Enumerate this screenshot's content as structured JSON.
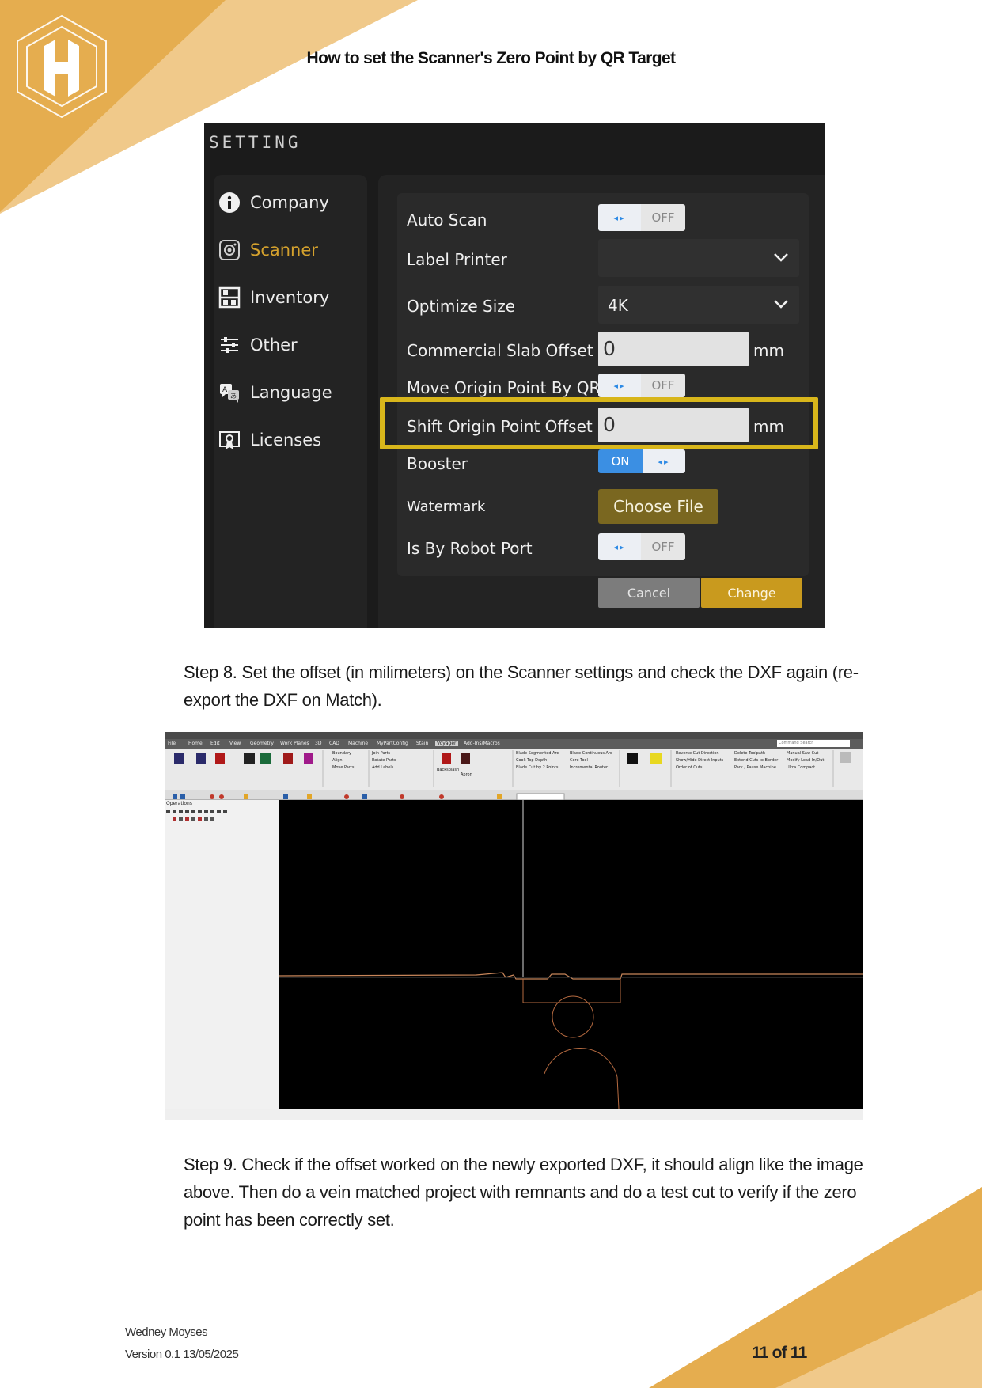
{
  "document": {
    "title": "How to set the Scanner's Zero Point by QR Target",
    "step8": "Step 8. Set the offset (in milimeters) on the Scanner settings and check the DXF again (re-export the DXF on Match).",
    "step9": "Step 9. Check if the offset worked on the newly exported DXF, it should align like the image above. Then do a vein matched project with remnants and do a test cut to verify if the zero point has been correctly set."
  },
  "settings_screenshot": {
    "title": "SETTING",
    "sidebar": [
      {
        "label": "Company",
        "icon": "info-icon"
      },
      {
        "label": "Scanner",
        "icon": "camera-icon",
        "active": true
      },
      {
        "label": "Inventory",
        "icon": "inventory-icon"
      },
      {
        "label": "Other",
        "icon": "sliders-icon"
      },
      {
        "label": "Language",
        "icon": "language-icon"
      },
      {
        "label": "Licenses",
        "icon": "license-icon"
      }
    ],
    "fields": {
      "auto_scan": {
        "label": "Auto Scan",
        "state": "OFF"
      },
      "label_printer": {
        "label": "Label Printer",
        "value": ""
      },
      "optimize_size": {
        "label": "Optimize Size",
        "value": "4K"
      },
      "commercial_slab_offset": {
        "label": "Commercial Slab Offset",
        "value": "0",
        "unit": "mm"
      },
      "move_origin": {
        "label": "Move Origin Point By QR",
        "state": "OFF"
      },
      "shift_origin": {
        "label": "Shift Origin Point Offset",
        "value": "0",
        "unit": "mm"
      },
      "booster": {
        "label": "Booster",
        "state": "ON"
      },
      "watermark": {
        "label": "Watermark",
        "button": "Choose File"
      },
      "robot_port": {
        "label": "Is By Robot Port",
        "state": "OFF"
      }
    },
    "buttons": {
      "cancel": "Cancel",
      "change": "Change"
    },
    "colors": {
      "accent": "#d4a12d",
      "highlight": "#d8b61b",
      "toggle_on": "#3b8fe3"
    }
  },
  "cad_screenshot": {
    "menu": [
      "File",
      "Home",
      "Edit",
      "View",
      "Geometry",
      "Work Planes",
      "3D",
      "CAD",
      "Machine",
      "MyPartConfig",
      "Stain",
      "Voyager",
      "Add-Ins/Macros"
    ],
    "search_placeholder": "Command Search",
    "operations_title": "Operations",
    "ribbon_labels": [
      "Boundary",
      "Align",
      "Move Parts",
      "Join Parts",
      "Rotate Parts",
      "Add Labels",
      "Blade Segmented Arc",
      "Cook Top Depth",
      "Blade Cut by 2 Points",
      "Blade Continuous Arc",
      "Core Tool",
      "Incremental Router",
      "Backsplash",
      "Apron",
      "Reverse Cut Direction",
      "Show/Hide Direct Inputs",
      "Order of Cuts",
      "Delete Toolpath",
      "Extend Cuts to Border",
      "Park / Pause Machine",
      "Manual Saw Cut",
      "Modify Lead-In/Out",
      "Ultra Compact"
    ]
  },
  "footer": {
    "author": "Wedney Moyses",
    "version": "Version 0.1 13/05/2025",
    "page": "11 of 11"
  }
}
